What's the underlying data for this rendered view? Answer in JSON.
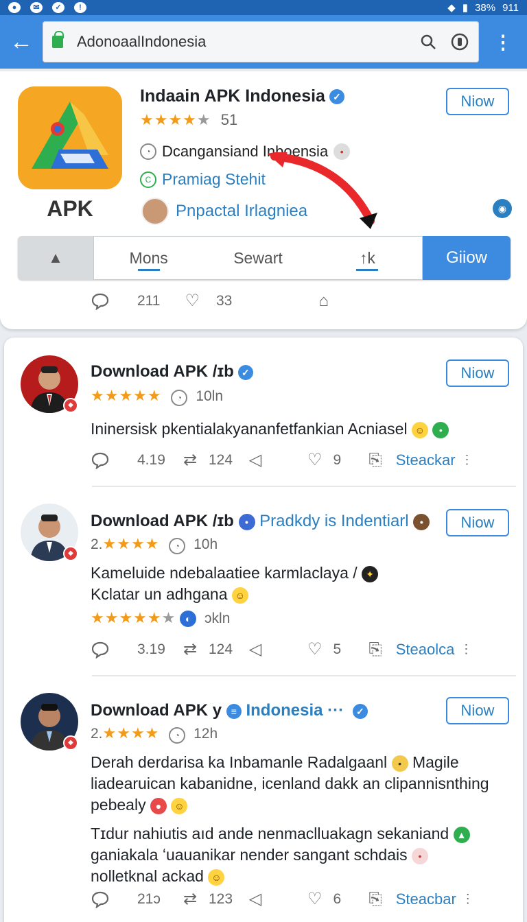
{
  "status_bar": {
    "battery": "38%",
    "time": "911"
  },
  "browser": {
    "url": "AdonoaalIndonesia"
  },
  "app_card": {
    "icon_label": "APK",
    "title": "Indaain APK Indonesia",
    "rating_count": "51",
    "developer": "Dcangansiand Inboensia",
    "promo": "Pramiag Stehit",
    "person": "Pnpactal Irlagniea",
    "now_label": "Niow",
    "tabs": [
      "Mons",
      "Sewart",
      "↑k"
    ],
    "go_label": "Giiow",
    "comments": "211",
    "likes": "33"
  },
  "posts": [
    {
      "title": "Download APK /ɪb",
      "title_extra": "",
      "rating_prefix": "",
      "time": "10ln",
      "body": [
        "Ininersisk pkentialakyananfetfankian Acniasel"
      ],
      "extra_rating_label": "",
      "now_label": "Niow",
      "comments": "4.19",
      "reposts": "124",
      "likes": "9",
      "share_label": "Steackar"
    },
    {
      "title": "Download APK /ɪb",
      "title_extra": "Pradkdy is Indentiarl",
      "rating_prefix": "2.",
      "time": "10h",
      "body": [
        "Kameluide ndebalaatiee karmlaclaya /",
        "Kclatar un adhgana"
      ],
      "extra_rating_label": "ɔkln",
      "now_label": "Niow",
      "comments": "3.19",
      "reposts": "124",
      "likes": "5",
      "share_label": "Steaolca"
    },
    {
      "title": "Download APK y",
      "title_extra": "Indonesia ···",
      "rating_prefix": "2.",
      "time": "12h",
      "body": [
        "Derah derdarisa ka Inbamanle Radalgaanl",
        "liadearuican kabanidne, icenland dakk an clipannisnthing",
        "pebealy"
      ],
      "body_tail": "Magile",
      "body2": [
        "Tɪdur nahiutis aıd ande nenmaclluakagn sekaniand",
        "ganiakala ʻuauanikar nender sangant schdais",
        "nolletknal ackad"
      ],
      "now_label": "Niow",
      "comments": "21ɔ",
      "reposts": "123",
      "likes": "6",
      "share_label": "Steacbar"
    }
  ]
}
